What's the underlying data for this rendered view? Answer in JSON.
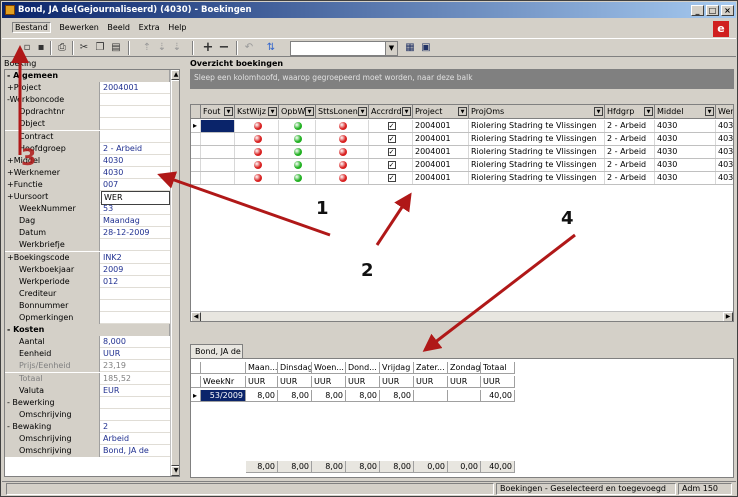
{
  "window": {
    "title": "Bond, JA de(Gejournaliseerd) (4030) - Boekingen"
  },
  "menu": [
    "Bestand",
    "Bewerken",
    "Beeld",
    "Extra",
    "Help"
  ],
  "left_panel": {
    "label": "Boeking",
    "rows": [
      {
        "k": "- Algemeen",
        "v": "",
        "sec": true
      },
      {
        "k": "+Project",
        "v": "2004001"
      },
      {
        "k": "-Werkboncode",
        "v": ""
      },
      {
        "k": "Opdrachtnr",
        "v": ""
      },
      {
        "k": "Object",
        "v": ""
      },
      {
        "k": "Contract",
        "v": ""
      },
      {
        "k": "Hoofdgroep",
        "v": "2 - Arbeid"
      },
      {
        "k": "+Middel",
        "v": "4030"
      },
      {
        "k": "+Werknemer",
        "v": "4030"
      },
      {
        "k": "+Functie",
        "v": "007"
      },
      {
        "k": "+Uursoort",
        "v": "WER",
        "hl": true
      },
      {
        "k": "WeekNummer",
        "v": "53"
      },
      {
        "k": "Dag",
        "v": "Maandag"
      },
      {
        "k": "Datum",
        "v": "28-12-2009"
      },
      {
        "k": "Werkbriefje",
        "v": ""
      },
      {
        "k": "+Boekingscode",
        "v": "INK2"
      },
      {
        "k": "Werkboekjaar",
        "v": "2009"
      },
      {
        "k": "Werkperiode",
        "v": "012"
      },
      {
        "k": "Crediteur",
        "v": ""
      },
      {
        "k": "Bonnummer",
        "v": ""
      },
      {
        "k": "Opmerkingen",
        "v": ""
      },
      {
        "k": "- Kosten",
        "v": "",
        "sec": true
      },
      {
        "k": "Aantal",
        "v": "8,000"
      },
      {
        "k": "Eenheid",
        "v": "UUR"
      },
      {
        "k": "Prijs/Eenheid",
        "v": "23,19",
        "grey": true
      },
      {
        "k": "Totaal",
        "v": "185,52",
        "grey": true
      },
      {
        "k": "Valuta",
        "v": "EUR"
      },
      {
        "k": "- Bewerking",
        "v": ""
      },
      {
        "k": "Omschrijving",
        "v": ""
      },
      {
        "k": "- Bewaking",
        "v": "2"
      },
      {
        "k": "Omschrijving",
        "v": "Arbeid"
      },
      {
        "k": "Omschrijving",
        "v": "Bond, JA de"
      }
    ]
  },
  "overview": {
    "title": "Overzicht boekingen",
    "group_hint": "Sleep een kolomhoofd, waarop gegroepeerd moet worden, naar deze balk",
    "columns": [
      "Fout",
      "KstWijz",
      "OpbWijz",
      "SttsLonen",
      "Accrdrd",
      "Project",
      "ProjOms",
      "Hfdgrp",
      "Middel",
      "Wer"
    ],
    "rows": [
      {
        "project": "2004001",
        "projoms": "Riolering Stadring te Vlissingen",
        "hfdgrp": "2 - Arbeid",
        "middel": "4030",
        "wer": "403"
      },
      {
        "project": "2004001",
        "projoms": "Riolering Stadring te Vlissingen",
        "hfdgrp": "2 - Arbeid",
        "middel": "4030",
        "wer": "403"
      },
      {
        "project": "2004001",
        "projoms": "Riolering Stadring te Vlissingen",
        "hfdgrp": "2 - Arbeid",
        "middel": "4030",
        "wer": "403"
      },
      {
        "project": "2004001",
        "projoms": "Riolering Stadring te Vlissingen",
        "hfdgrp": "2 - Arbeid",
        "middel": "4030",
        "wer": "403"
      },
      {
        "project": "2004001",
        "projoms": "Riolering Stadring te Vlissingen",
        "hfdgrp": "2 - Arbeid",
        "middel": "4030",
        "wer": "403"
      }
    ],
    "colors": {
      "red": "#d82020",
      "green": "#20b020"
    }
  },
  "week": {
    "tab": "Bond, JA de",
    "headers": [
      "Maan...",
      "Dinsdag",
      "Woen...",
      "Dond...",
      "Vrijdag",
      "Zater...",
      "Zondag",
      "Totaal"
    ],
    "units": [
      "WeekNr",
      "UUR",
      "UUR",
      "UUR",
      "UUR",
      "UUR",
      "UUR",
      "UUR",
      "UUR"
    ],
    "row": [
      "53/2009",
      "8,00",
      "8,00",
      "8,00",
      "8,00",
      "8,00",
      "",
      "",
      "40,00"
    ],
    "totals": [
      "8,00",
      "8,00",
      "8,00",
      "8,00",
      "8,00",
      "0,00",
      "0,00",
      "40,00"
    ]
  },
  "status": {
    "message": "Boekingen - Geselecteerd en toegevoegd",
    "admin": "Adm 150"
  },
  "annotations": [
    "1",
    "2",
    "3",
    "4"
  ]
}
